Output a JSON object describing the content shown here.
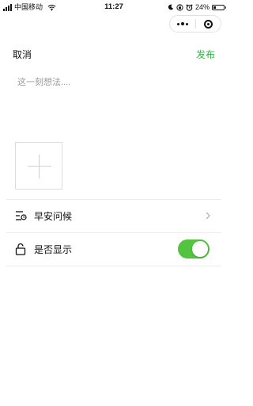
{
  "status_bar": {
    "carrier": "中国移动",
    "time": "11:27",
    "battery_text": "24%",
    "battery_level": 0.24,
    "icons": [
      "signal-icon",
      "wifi-icon",
      "moon-icon",
      "lock-rotation-icon",
      "alarm-icon",
      "battery-icon"
    ]
  },
  "capsule": {
    "more_icon": "more-dots-icon",
    "close_icon": "close-circle-icon"
  },
  "header": {
    "cancel_label": "取消",
    "publish_label": "发布"
  },
  "compose": {
    "placeholder": "这一刻想法....",
    "value": ""
  },
  "add_image": {
    "icon": "plus-icon"
  },
  "options": [
    {
      "icon": "greeting-list-icon",
      "label": "早安问候",
      "control": "chevron-right-icon"
    },
    {
      "icon": "unlock-icon",
      "label": "是否显示",
      "control": "toggle",
      "checked": true
    }
  ],
  "colors": {
    "accent": "#2fb540",
    "toggle_on": "#53c340",
    "placeholder": "#9a9a9a",
    "divider": "#ececec"
  }
}
